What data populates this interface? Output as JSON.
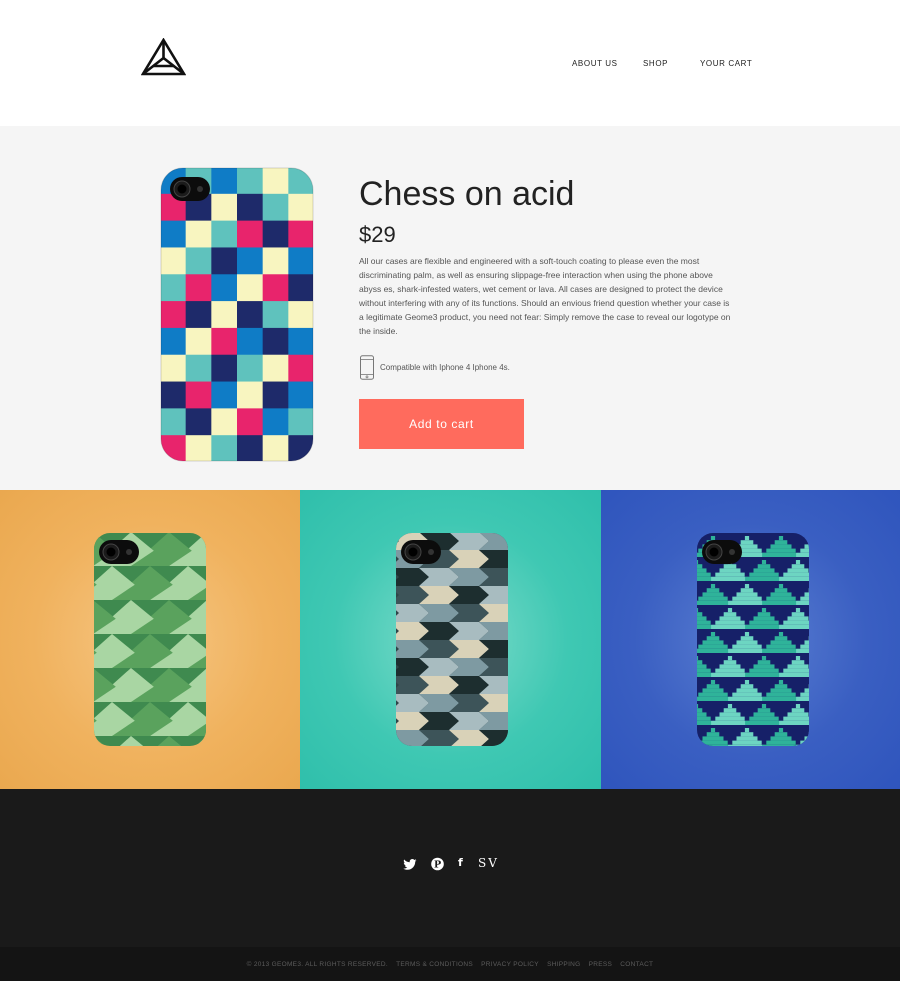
{
  "header": {
    "logo_icon": "triangle-logo-icon",
    "nav": [
      "ABOUT US",
      "SHOP",
      "YOUR CART"
    ]
  },
  "product": {
    "title": "Chess on acid",
    "price": "$29",
    "description": "All our cases are flexible and engineered with a soft-touch coating to please even the most discriminating palm, as well as ensuring slippage-free interaction when using the phone above abyss es, shark-infested waters, wet cement or lava. All cases are designed to protect the device without interfering with any of its functions. Should an envious friend question whether your case is a legitimate Geome3 product, you need not fear: Simply remove the case to reveal our logotype on the inside.",
    "compat_icon": "phone-icon",
    "compatibility": "Compatible with Iphone 4 Iphone 4s.",
    "add_to_cart": "Add to cart",
    "colors": {
      "button": "#ff6b5d",
      "background": "#f5f5f5"
    }
  },
  "gallery": {
    "tiles": [
      {
        "background": "#f0b25e",
        "pattern": "green-triangles"
      },
      {
        "background": "#3fc8b3",
        "pattern": "chevron-stripes"
      },
      {
        "background": "#3a5fc2",
        "pattern": "pixel-triangles"
      }
    ]
  },
  "footer": {
    "social": [
      {
        "icon": "twitter-icon"
      },
      {
        "icon": "pinterest-icon",
        "label": "P"
      },
      {
        "icon": "facebook-icon",
        "label": "f"
      },
      {
        "icon": "sv-icon",
        "label": "SV"
      }
    ],
    "legal": [
      "© 2013 GEOME3. ALL RIGHTS RESERVED.",
      "TERMS & CONDITIONS",
      "PRIVACY POLICY",
      "SHIPPING",
      "PRESS",
      "CONTACT"
    ]
  }
}
